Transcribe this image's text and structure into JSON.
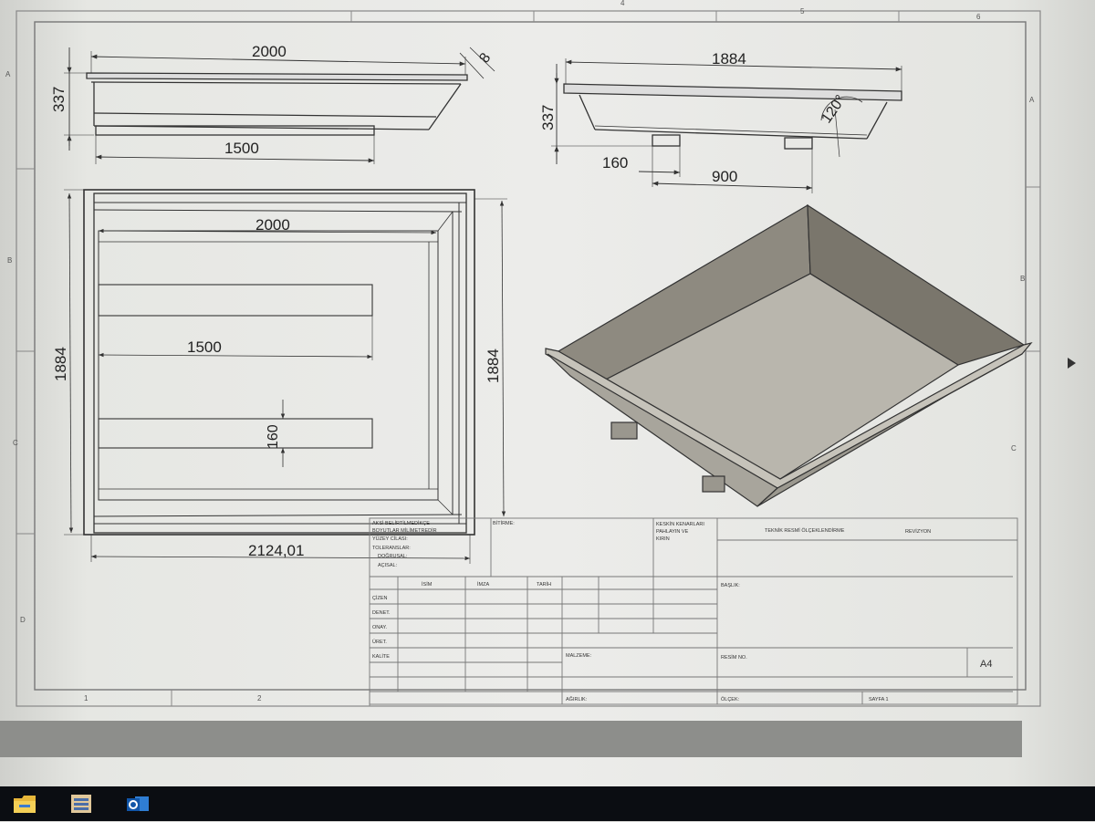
{
  "drawing": {
    "border_columns": [
      "1",
      "2",
      "4",
      "5",
      "6"
    ],
    "border_rows": [
      "A",
      "B",
      "C",
      "D"
    ],
    "front_view": {
      "width": "2000",
      "height": "337",
      "bottom": "1500",
      "lip": "8"
    },
    "side_view": {
      "width": "1884",
      "height": "337",
      "leg_width": "160",
      "leg_spacing": "900",
      "angle": "120°"
    },
    "top_view": {
      "inner_width": "2000",
      "rail_length": "1500",
      "rail_gap": "160",
      "height_left": "1884",
      "height_right": "1884",
      "overall_width": "2124,01"
    }
  },
  "title_block": {
    "notes": [
      "AKSİ BELİRTİLMEDİKÇE",
      "BOYUTLAR MİLİMETREDİR",
      "YÜZEY CİLASI:",
      "TOLERANSLAR:",
      "DOĞRUSAL:",
      "AÇISAL:"
    ],
    "finish_label": "BİTİRME:",
    "edges_label": [
      "KESKİN KENARLARI",
      "PAHLAYIN VE",
      "KIRIN"
    ],
    "scale_note": "TEKNİK RESMİ ÖLÇEKLENDİRME",
    "revision_label": "REVİZYON",
    "columns": [
      "İSİM",
      "İMZA",
      "TARİH"
    ],
    "rows": [
      "ÇİZEN",
      "DENET.",
      "ONAY.",
      "ÜRET.",
      "KALİTE"
    ],
    "title_label": "BAŞLIK:",
    "material_label": "MALZEME:",
    "drawing_no_label": "RESİM NO.",
    "paper_size": "A4",
    "weight_label": "AĞIRLIK:",
    "scale_label": "ÖLÇEK:",
    "sheet_label": "SAYFA 1"
  },
  "taskbar": {
    "icons": [
      "file-explorer-icon",
      "file-manager-icon",
      "outlook-icon"
    ]
  }
}
